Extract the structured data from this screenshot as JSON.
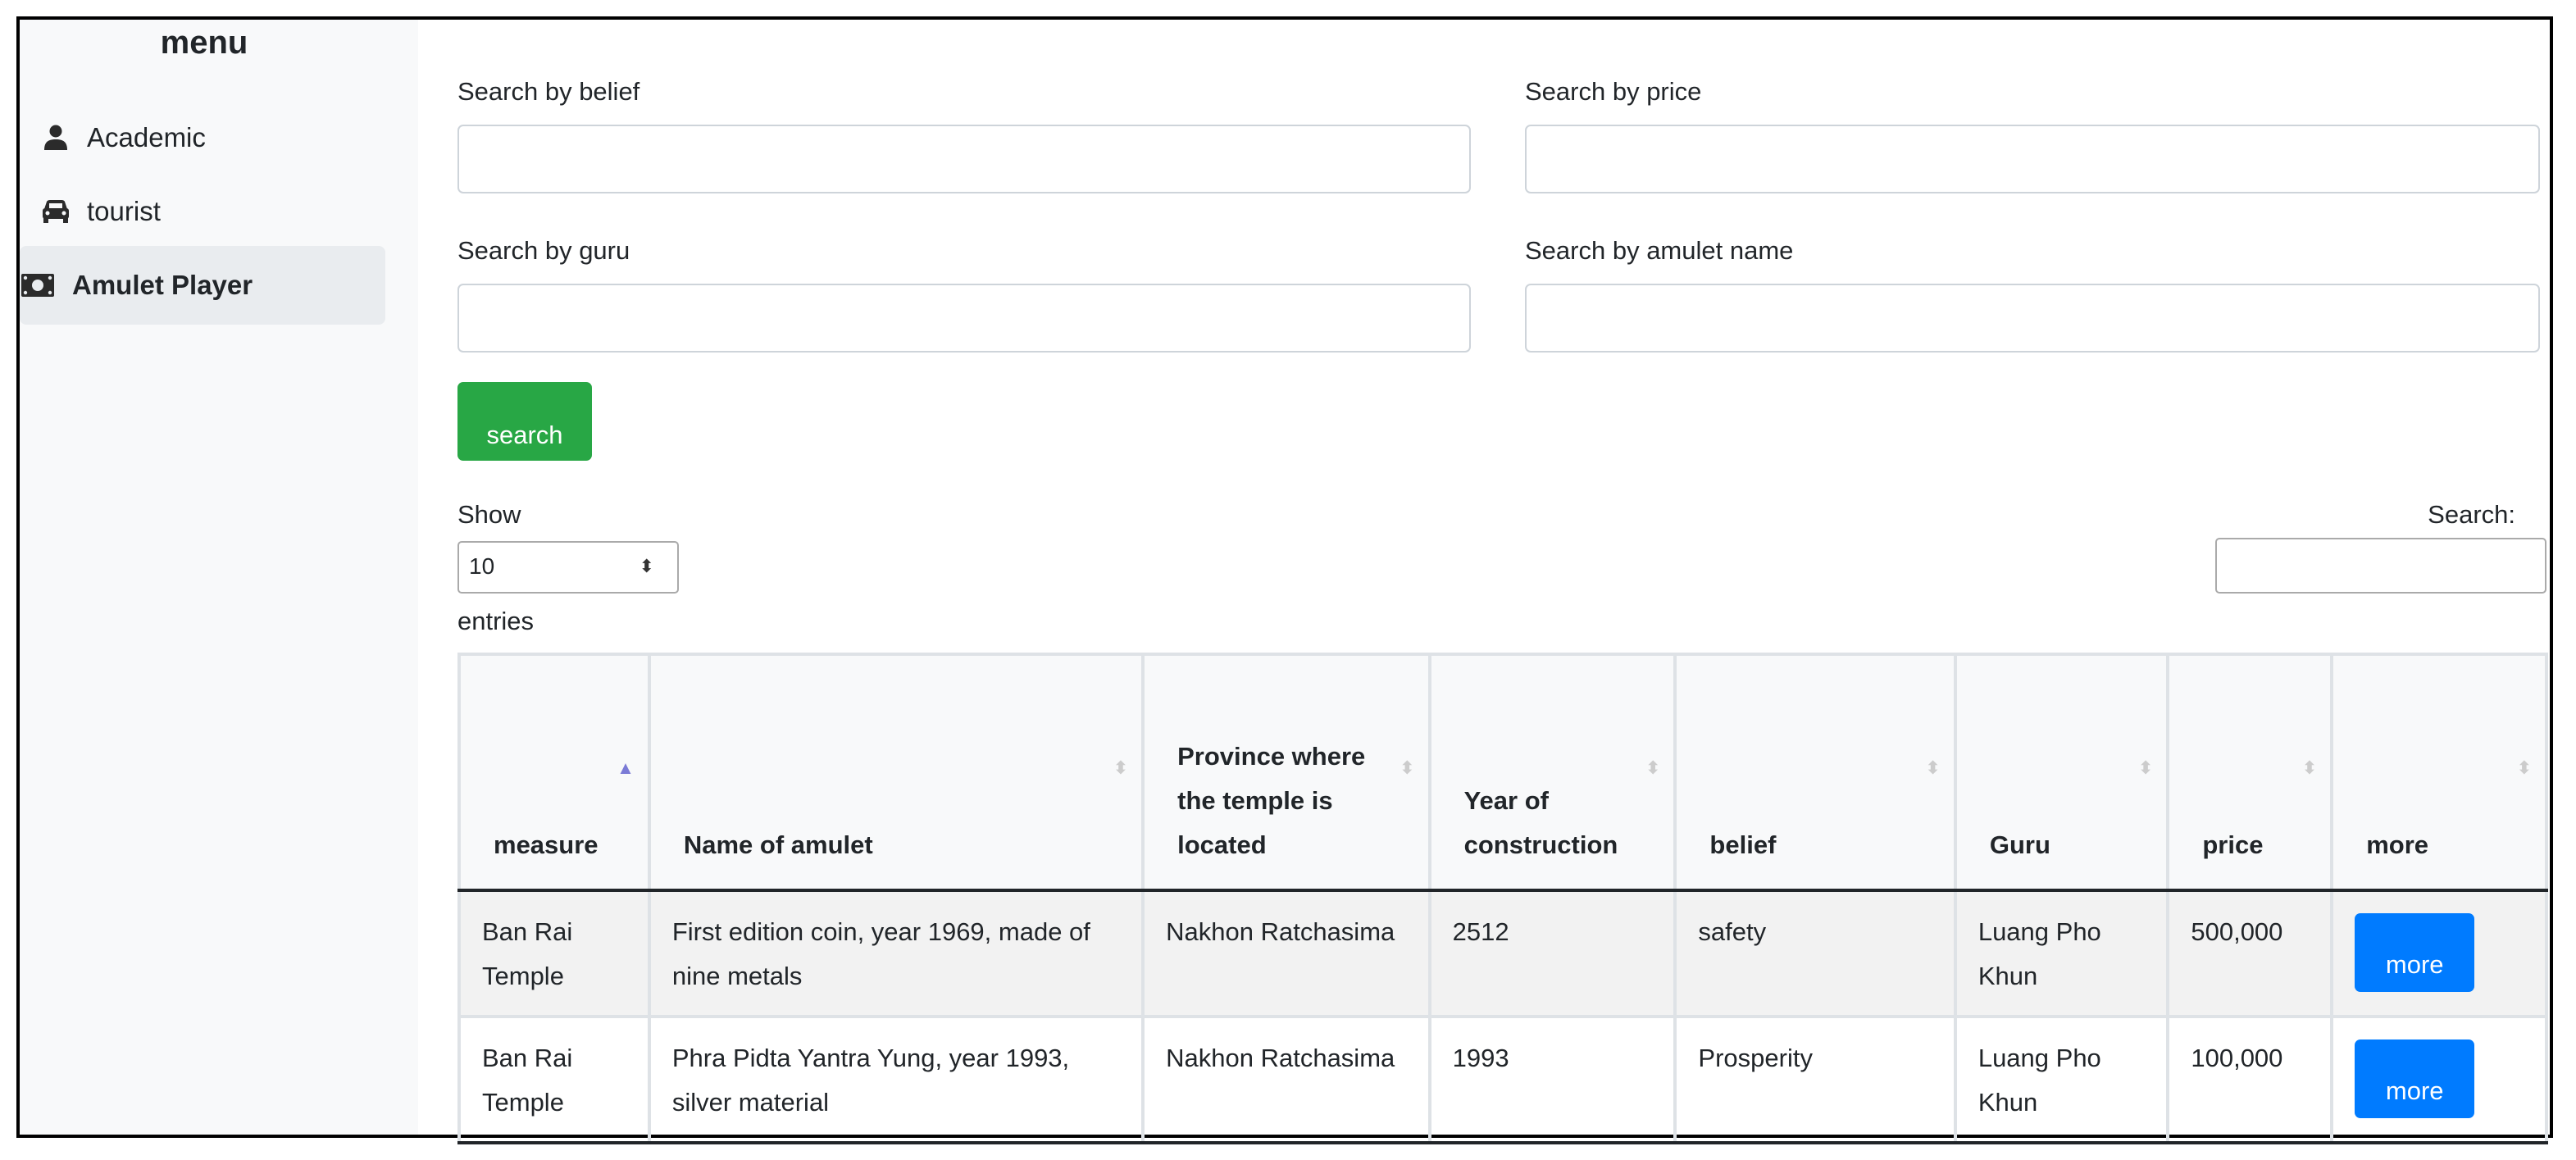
{
  "sidebar": {
    "title": "menu",
    "items": [
      {
        "label": "Academic",
        "icon": "user-icon",
        "active": false
      },
      {
        "label": "tourist",
        "icon": "car-icon",
        "active": false
      },
      {
        "label": "Amulet Player",
        "icon": "money-bill-icon",
        "active": true
      }
    ]
  },
  "filters": {
    "belief_label": "Search by belief",
    "belief_value": "",
    "price_label": "Search by price",
    "price_value": "",
    "guru_label": "Search by guru",
    "guru_value": "",
    "name_label": "Search by amulet name",
    "name_value": "",
    "search_button": "search"
  },
  "datatable": {
    "show_label": "Show",
    "page_length": "10",
    "entries_label": "entries",
    "search_label": "Search:",
    "search_value": "",
    "columns": [
      {
        "label": "measure",
        "sort": "asc"
      },
      {
        "label": "Name of amulet",
        "sort": "none"
      },
      {
        "label": "Province where the temple is located",
        "sort": "none"
      },
      {
        "label": "Year of construction",
        "sort": "none"
      },
      {
        "label": "belief",
        "sort": "none"
      },
      {
        "label": "Guru",
        "sort": "none"
      },
      {
        "label": "price",
        "sort": "none"
      },
      {
        "label": "more",
        "sort": "none"
      }
    ],
    "rows": [
      {
        "measure": "Ban Rai Temple",
        "name": "First edition coin, year 1969, made of nine metals",
        "province": "Nakhon Ratchasima",
        "year": "2512",
        "belief": "safety",
        "guru": "Luang Pho Khun",
        "price": "500,000",
        "more": "more"
      },
      {
        "measure": "Ban Rai Temple",
        "name": "Phra Pidta Yantra Yung, year 1993, silver material",
        "province": "Nakhon Ratchasima",
        "year": "1993",
        "belief": "Prosperity",
        "guru": "Luang Pho Khun",
        "price": "100,000",
        "more": "more"
      }
    ]
  },
  "colors": {
    "success": "#28a745",
    "primary": "#007bff",
    "sidebar_bg": "#f8f9fa",
    "active_item_bg": "#e9ecef"
  }
}
